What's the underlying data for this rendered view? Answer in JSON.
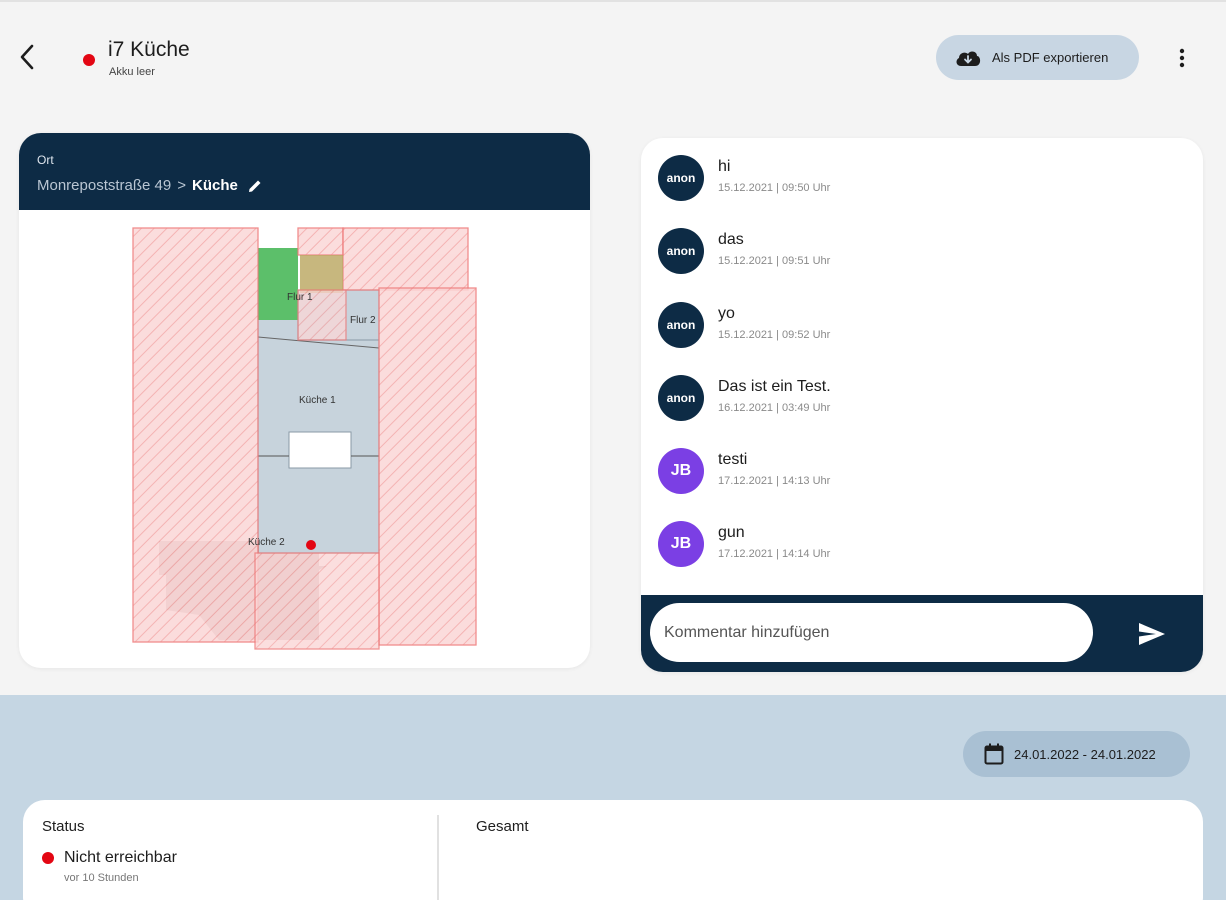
{
  "header": {
    "back_icon": "chevron-left-icon",
    "device_name": "i7 Küche",
    "device_subtitle": "Akku leer",
    "status_color": "#e30613",
    "export_button": "Als PDF exportieren",
    "export_icon": "cloud-download-icon",
    "more_icon": "more-vertical-icon"
  },
  "location": {
    "label": "Ort",
    "building": "Monrepoststraße 49",
    "separator": ">",
    "room": "Küche",
    "edit_icon": "pencil-icon"
  },
  "floorplan": {
    "rooms": [
      "Flur 1",
      "Flur 2",
      "Küche 1",
      "Küche 2"
    ]
  },
  "comments": [
    {
      "avatar": "anon",
      "text": "hi",
      "time": "15.12.2021 | 09:50 Uhr"
    },
    {
      "avatar": "anon",
      "text": "das",
      "time": "15.12.2021 | 09:51 Uhr"
    },
    {
      "avatar": "anon",
      "text": "yo",
      "time": "15.12.2021 | 09:52 Uhr"
    },
    {
      "avatar": "anon",
      "text": "Das ist ein Test.",
      "time": "16.12.2021 | 03:49 Uhr"
    },
    {
      "avatar": "JB",
      "text": "testi",
      "time": "17.12.2021 | 14:13 Uhr"
    },
    {
      "avatar": "JB",
      "text": "gun",
      "time": "17.12.2021 | 14:14 Uhr"
    }
  ],
  "comment_input": {
    "placeholder": "Kommentar hinzufügen",
    "send_icon": "send-icon"
  },
  "date_range": {
    "label": "24.01.2022 - 24.01.2022",
    "icon": "calendar-icon"
  },
  "stats": {
    "status_label": "Status",
    "status_value": "Nicht erreichbar",
    "status_ago": "vor 10 Stunden",
    "total_label": "Gesamt"
  },
  "colors": {
    "navy": "#0d2b45",
    "accent_purple": "#7b3fe4",
    "status_red": "#e30613",
    "button_bg": "#c8d6e3",
    "bottom_bg": "#c5d6e3"
  }
}
